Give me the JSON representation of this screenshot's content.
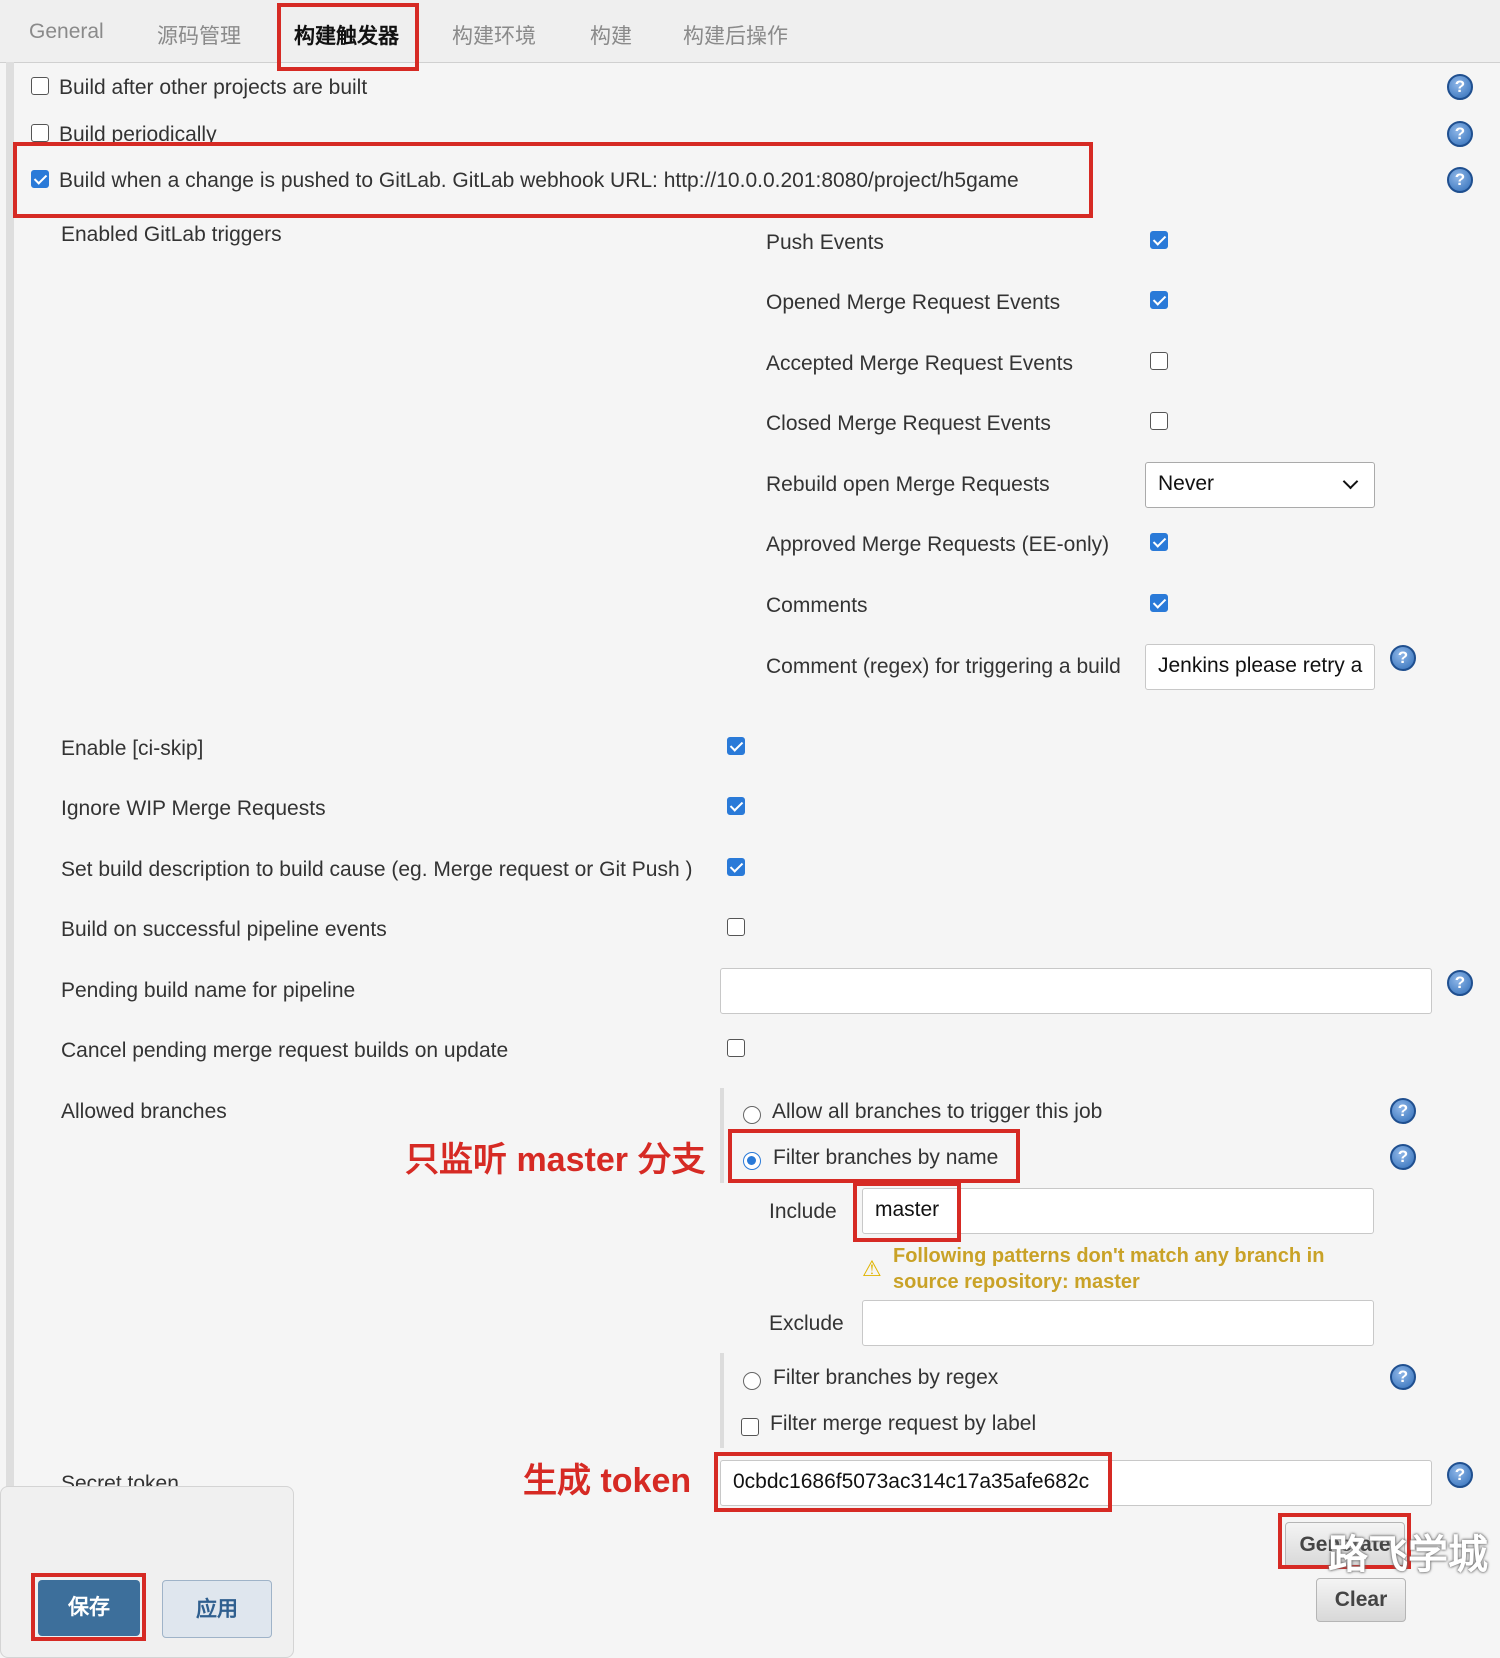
{
  "tabs": [
    "General",
    "源码管理",
    "构建触发器",
    "构建环境",
    "构建",
    "构建后操作"
  ],
  "triggers": {
    "build_after_other": "Build after other projects are built",
    "build_periodically": "Build periodically",
    "build_on_push": "Build when a change is pushed to GitLab. GitLab webhook URL: http://10.0.0.201:8080/project/h5game"
  },
  "gitlab": {
    "enabled_triggers_label": "Enabled GitLab triggers",
    "push_events": "Push Events",
    "opened_mr_events": "Opened Merge Request Events",
    "accepted_mr_events": "Accepted Merge Request Events",
    "closed_mr_events": "Closed Merge Request Events",
    "rebuild_open_mr": "Rebuild open Merge Requests",
    "rebuild_value": "Never",
    "approved_mr": "Approved Merge Requests (EE-only)",
    "comments": "Comments",
    "comment_regex": "Comment (regex) for triggering a build",
    "comment_regex_value": "Jenkins please retry a",
    "enable_ci_skip": "Enable [ci-skip]",
    "ignore_wip": "Ignore WIP Merge Requests",
    "set_build_desc": "Set build description to build cause (eg. Merge request or Git Push )",
    "build_on_pipeline": "Build on successful pipeline events",
    "pending_build_name": "Pending build name for pipeline",
    "cancel_pending": "Cancel pending merge request builds on update",
    "allowed_branches": "Allowed branches",
    "allow_all": "Allow all branches to trigger this job",
    "filter_by_name": "Filter branches by name",
    "include_label": "Include",
    "include_value": "master",
    "warning": "Following patterns don't match any branch in source repository: master",
    "exclude_label": "Exclude",
    "filter_by_regex": "Filter branches by regex",
    "filter_by_label": "Filter merge request by label",
    "secret_token_label": "Secret token",
    "secret_token_value": "0cbdc1686f5073ac314c17a35afe682c"
  },
  "buttons": {
    "generate": "Generate",
    "clear": "Clear",
    "save": "保存",
    "apply": "应用"
  },
  "annotations": {
    "master_only": "只监听 master 分支",
    "generate_token": "生成 token"
  },
  "watermark": "路飞学城",
  "colors": {
    "accent": "#2a7ad8",
    "highlight": "#d62a24",
    "warning": "#c9a227"
  }
}
